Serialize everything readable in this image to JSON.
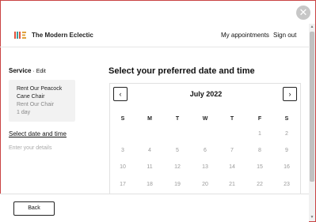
{
  "header": {
    "brand": "The Modern Eclectic",
    "logo_text": "ME",
    "nav": {
      "appointments": "My appointments",
      "sign_out": "Sign out"
    }
  },
  "close_glyph": "✕",
  "sidebar": {
    "service_label": "Service",
    "separator": " · ",
    "edit_label": "Edit",
    "service_card": {
      "title_line1": "Rent Our Peacock",
      "title_line2": "Cane Chair",
      "subtitle": "Rent Our Chair",
      "duration": "1 day"
    },
    "steps": {
      "select_date": "Select date and time",
      "enter_details": "Enter your details"
    }
  },
  "main": {
    "title": "Select your preferred date and time"
  },
  "calendar": {
    "month": "July",
    "year": "2022",
    "prev_glyph": "‹",
    "next_glyph": "›",
    "weekdays": [
      "S",
      "M",
      "T",
      "W",
      "T",
      "F",
      "S"
    ],
    "weeks": [
      [
        "",
        "",
        "",
        "",
        "",
        "1",
        "2"
      ],
      [
        "3",
        "4",
        "5",
        "6",
        "7",
        "8",
        "9"
      ],
      [
        "10",
        "11",
        "12",
        "13",
        "14",
        "15",
        "16"
      ],
      [
        "17",
        "18",
        "19",
        "20",
        "21",
        "22",
        "23"
      ]
    ]
  },
  "footer": {
    "back_label": "Back"
  },
  "colors": {
    "border_accent": "#c94343",
    "logo_m": "#e0533d",
    "logo_e": "#3aa0a0"
  }
}
